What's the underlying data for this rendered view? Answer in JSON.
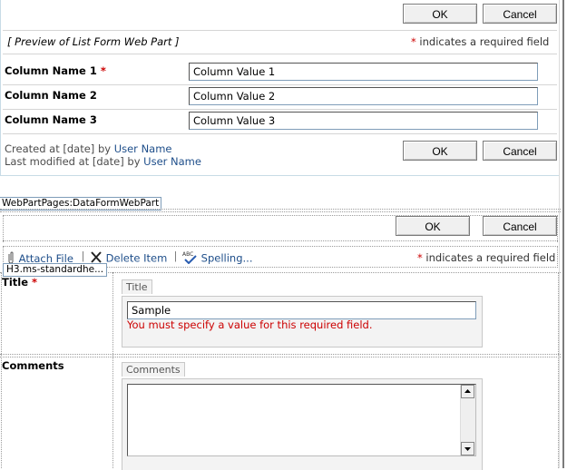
{
  "top_form": {
    "ok_label": "OK",
    "cancel_label": "Cancel",
    "preview_title": "[ Preview of List Form Web Part ]",
    "required_note": "indicates a required field",
    "required_marker": "*",
    "rows": [
      {
        "name": "Column Name 1",
        "required": "*",
        "value": "Column Value 1"
      },
      {
        "name": "Column Name 2",
        "required": "",
        "value": "Column Value 2"
      },
      {
        "name": "Column Name 3",
        "required": "",
        "value": "Column Value 3"
      }
    ],
    "created_prefix": "Created at [date] by",
    "modified_prefix": "Last modified at [date] by",
    "user_name": "User Name"
  },
  "webpart_tag": "WebPartPages:DataFormWebPart",
  "bottom_form": {
    "ok_label": "OK",
    "cancel_label": "Cancel",
    "toolbar": {
      "attach_file": "Attach File",
      "delete_item": "Delete Item",
      "spelling": "Spelling...",
      "separator": "|"
    },
    "required_marker": "*",
    "required_note": "indicates a required field",
    "tooltip": "H3.ms-standardhe...",
    "title_label": "Title",
    "title_required": "*",
    "title_legend": "Title",
    "title_value": "Sample",
    "title_error": "You must specify a value for this required field.",
    "comments_label": "Comments",
    "comments_legend": "Comments",
    "comments_value": ""
  },
  "colors": {
    "required": "#cc0000",
    "link": "#1e4e8a",
    "error": "#cc0000"
  }
}
